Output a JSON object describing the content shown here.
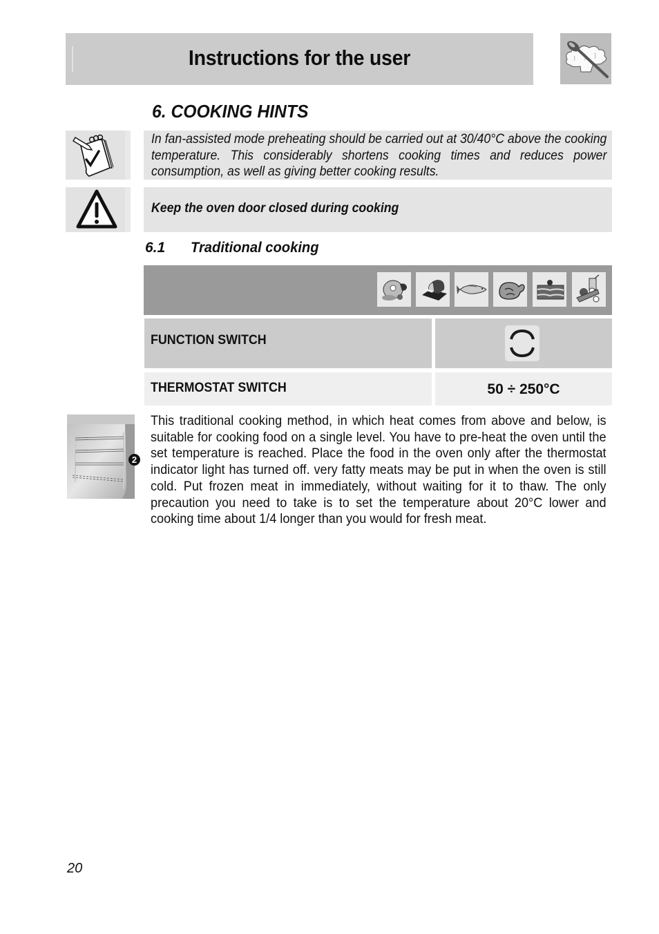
{
  "header": {
    "title": "Instructions for the user",
    "logo_icon": "chef-hat-spoon-icon"
  },
  "section": {
    "number": "6.",
    "title": "6.  COOKING HINTS"
  },
  "notes": [
    {
      "icon": "notepad-check-icon",
      "text": "In fan-assisted mode preheating should be carried out at 30/40°C above the cooking temperature. This considerably shortens cooking times and reduces power consumption, as well as giving better cooking results."
    },
    {
      "icon": "warning-icon",
      "text": "Keep the oven door closed during cooking"
    }
  ],
  "subsection": {
    "number": "6.1",
    "title": "Traditional cooking"
  },
  "table": {
    "food_icons": [
      "meat-icon",
      "bread-icon",
      "fish-icon",
      "poultry-icon",
      "cake-icon",
      "vegetables-icon"
    ],
    "rows": [
      {
        "label": "FUNCTION SWITCH",
        "value_icon": "top-bottom-heating-icon"
      },
      {
        "label": "THERMOSTAT SWITCH",
        "value": "50 ÷ 250°C"
      }
    ]
  },
  "oven_image": {
    "icon": "oven-shelf-icon",
    "shelf_badge": "2"
  },
  "body_text": "This traditional cooking method, in which heat comes from above and below, is suitable for cooking food on a single level. You have to pre-heat the oven until the set temperature is reached. Place the food in the oven only after the thermostat indicator light has turned off. very fatty meats may be put in when the oven is still cold. Put frozen meat in immediately, without waiting for it to thaw. The only precaution you need to take is to set the temperature about 20°C lower and cooking time about 1/4 longer than you would for fresh meat.",
  "page_number": "20"
}
